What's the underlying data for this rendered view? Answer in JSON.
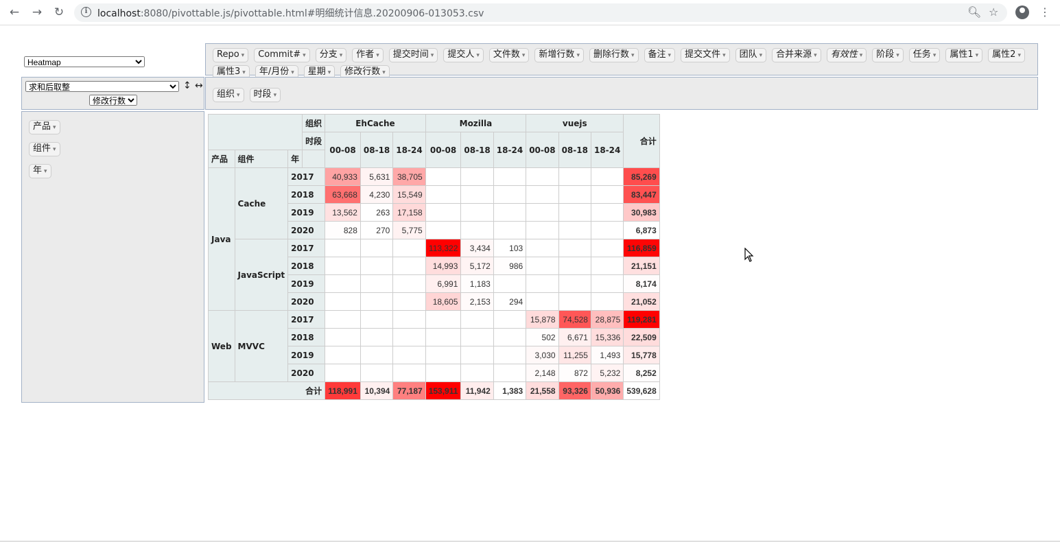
{
  "browser": {
    "url_host": "localhost",
    "url_rest": ":8080/pivottable.js/pivottable.html#明细统计信息.20200906-013053.csv"
  },
  "renderer": {
    "selected": "Heatmap"
  },
  "aggregator": {
    "selected": "求和后取整",
    "field": "修改行数",
    "sort_rows_icon": "↕",
    "sort_cols_icon": "↔"
  },
  "unused_attrs": [
    "Repo",
    "Commit#",
    "分支",
    "作者",
    "提交时间",
    "提交人",
    "文件数",
    "新增行数",
    "删除行数",
    "备注",
    "提交文件",
    "团队",
    "合并来源",
    "有效性",
    "阶段",
    "任务",
    "属性1",
    "属性2",
    "属性3",
    "年/月份",
    "星期",
    "修改行数"
  ],
  "col_attrs": [
    "组织",
    "时段"
  ],
  "row_attrs": [
    "产品",
    "组件",
    "年"
  ],
  "table": {
    "hdr_org": "组织",
    "hdr_period": "时段",
    "hdr_product": "产品",
    "hdr_component": "组件",
    "hdr_year": "年",
    "total_label": "合计",
    "orgs": [
      "EhCache",
      "Mozilla",
      "vuejs"
    ],
    "periods": [
      "00-08",
      "08-18",
      "18-24"
    ],
    "products": [
      {
        "name": "Java",
        "components": [
          {
            "name": "Cache",
            "rows": [
              {
                "year": "2017",
                "cells": [
                  "40,933",
                  "5,631",
                  "38,705",
                  "",
                  "",
                  "",
                  "",
                  "",
                  ""
                ],
                "total": "85,269"
              },
              {
                "year": "2018",
                "cells": [
                  "63,668",
                  "4,230",
                  "15,549",
                  "",
                  "",
                  "",
                  "",
                  "",
                  ""
                ],
                "total": "83,447"
              },
              {
                "year": "2019",
                "cells": [
                  "13,562",
                  "263",
                  "17,158",
                  "",
                  "",
                  "",
                  "",
                  "",
                  ""
                ],
                "total": "30,983"
              },
              {
                "year": "2020",
                "cells": [
                  "828",
                  "270",
                  "5,775",
                  "",
                  "",
                  "",
                  "",
                  "",
                  ""
                ],
                "total": "6,873"
              }
            ]
          },
          {
            "name": "JavaScript",
            "rows": [
              {
                "year": "2017",
                "cells": [
                  "",
                  "",
                  "",
                  "113,322",
                  "3,434",
                  "103",
                  "",
                  "",
                  ""
                ],
                "total": "116,859"
              },
              {
                "year": "2018",
                "cells": [
                  "",
                  "",
                  "",
                  "14,993",
                  "5,172",
                  "986",
                  "",
                  "",
                  ""
                ],
                "total": "21,151"
              },
              {
                "year": "2019",
                "cells": [
                  "",
                  "",
                  "",
                  "6,991",
                  "1,183",
                  "",
                  "",
                  "",
                  ""
                ],
                "total": "8,174"
              },
              {
                "year": "2020",
                "cells": [
                  "",
                  "",
                  "",
                  "18,605",
                  "2,153",
                  "294",
                  "",
                  "",
                  ""
                ],
                "total": "21,052"
              }
            ]
          }
        ]
      },
      {
        "name": "Web",
        "components": [
          {
            "name": "MVVC",
            "rows": [
              {
                "year": "2017",
                "cells": [
                  "",
                  "",
                  "",
                  "",
                  "",
                  "",
                  "15,878",
                  "74,528",
                  "28,875"
                ],
                "total": "119,281"
              },
              {
                "year": "2018",
                "cells": [
                  "",
                  "",
                  "",
                  "",
                  "",
                  "",
                  "502",
                  "6,671",
                  "15,336"
                ],
                "total": "22,509"
              },
              {
                "year": "2019",
                "cells": [
                  "",
                  "",
                  "",
                  "",
                  "",
                  "",
                  "3,030",
                  "11,255",
                  "1,493"
                ],
                "total": "15,778"
              },
              {
                "year": "2020",
                "cells": [
                  "",
                  "",
                  "",
                  "",
                  "",
                  "",
                  "2,148",
                  "872",
                  "5,232"
                ],
                "total": "8,252"
              }
            ]
          }
        ]
      }
    ],
    "col_totals": [
      "118,991",
      "10,394",
      "77,187",
      "153,911",
      "11,942",
      "1,383",
      "21,558",
      "93,326",
      "50,936"
    ],
    "grand_total": "539,628"
  }
}
